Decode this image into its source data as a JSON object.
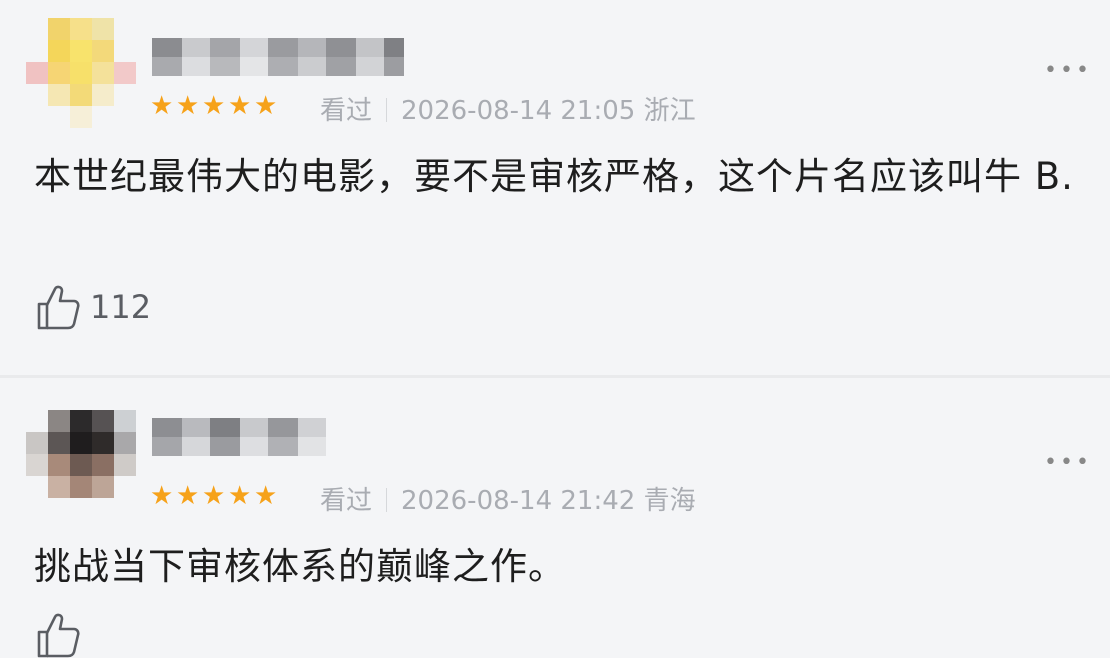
{
  "comments": [
    {
      "user_name": "",
      "rating_stars": 5,
      "watch_status": "看过",
      "datetime": "2026-08-14 21:05",
      "location": "浙江",
      "content": "本世纪最伟大的电影，要不是审核严格，这个片名应该叫牛 B.",
      "likes": "112",
      "avatar_icon": "pixelated-avatar",
      "more_icon": "more-dots-icon",
      "star_color": "#f6a21a"
    },
    {
      "user_name": "",
      "rating_stars": 5,
      "watch_status": "看过",
      "datetime": "2026-08-14 21:42",
      "location": "青海",
      "content": "挑战当下审核体系的巅峰之作。",
      "likes": "",
      "avatar_icon": "pixelated-avatar",
      "more_icon": "more-dots-icon",
      "star_color": "#f6a21a"
    }
  ],
  "ui": {
    "star_glyph": "★",
    "more_glyph": "•••"
  }
}
